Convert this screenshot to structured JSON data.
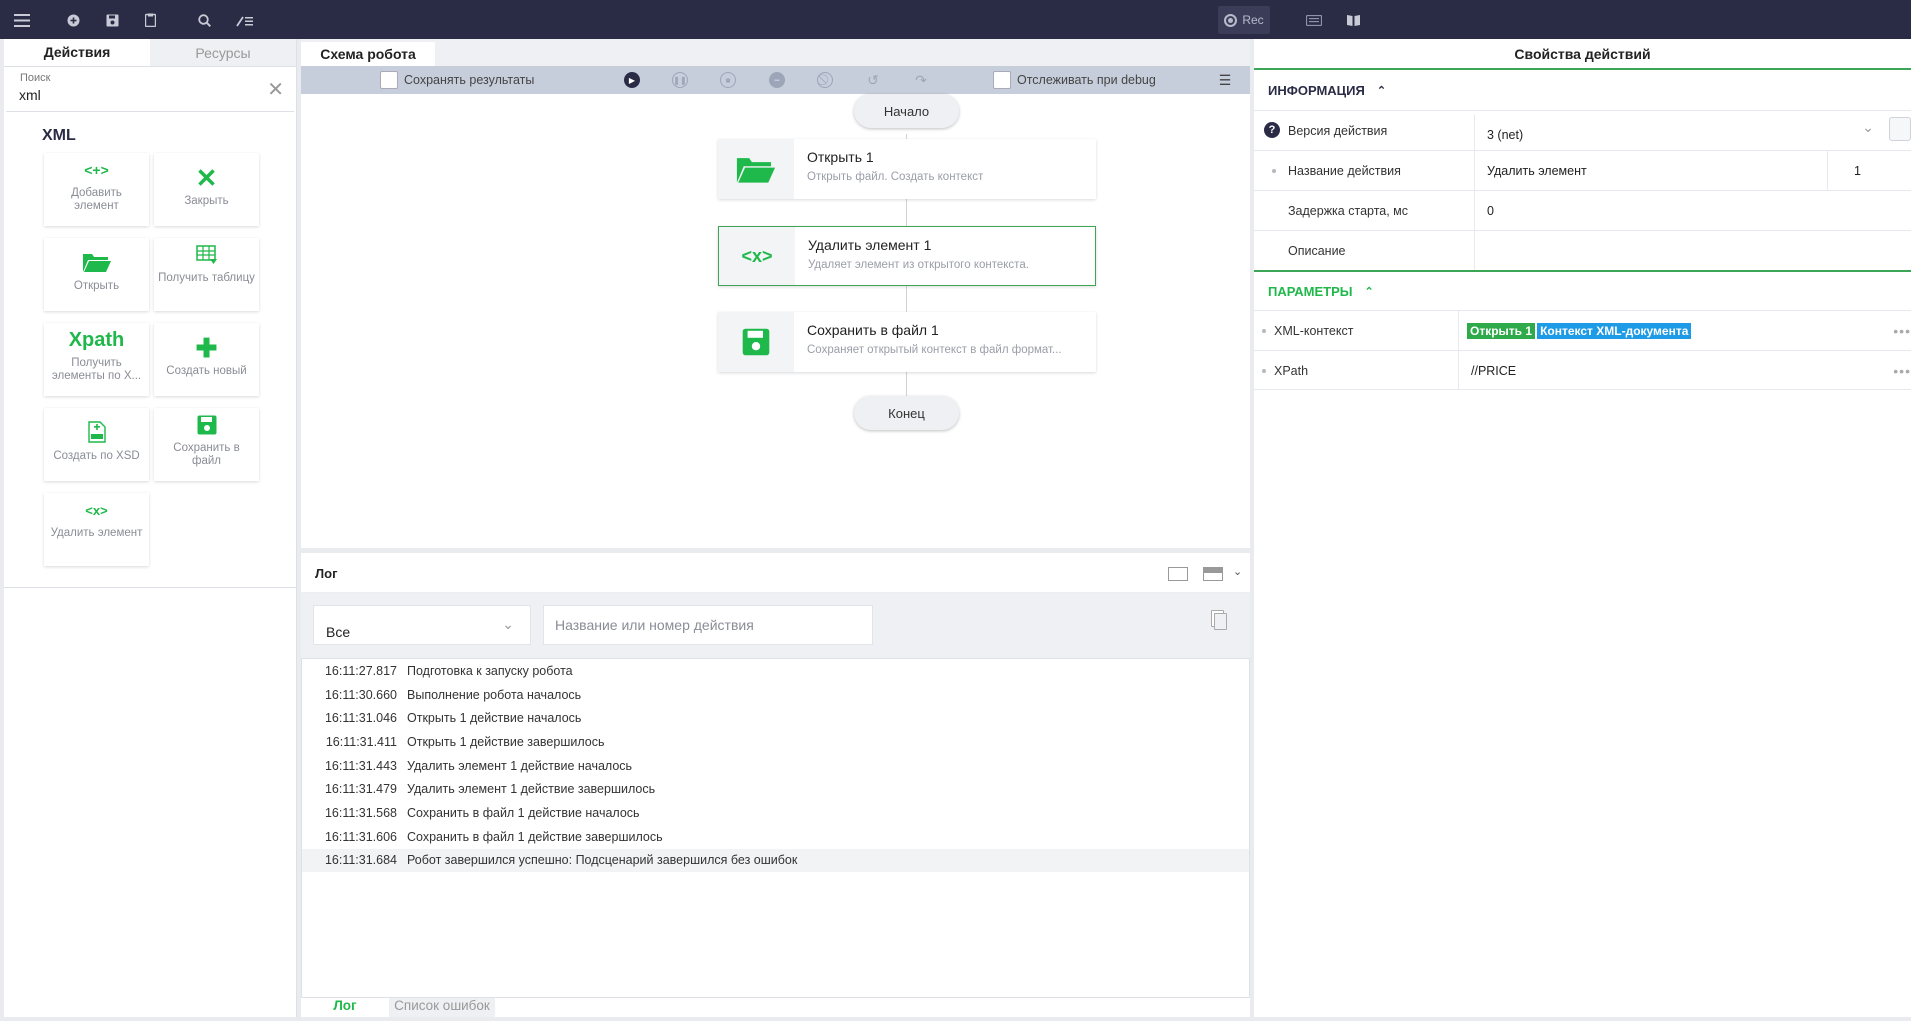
{
  "toolbar": {
    "rec_label": "Rec"
  },
  "left_panel": {
    "tabs": [
      "Действия",
      "Ресурсы"
    ],
    "search": {
      "label": "Поиск",
      "value": "xml"
    },
    "group_title": "XML",
    "tiles": [
      {
        "label": "Добавить элемент",
        "icon": "add-element-icon",
        "glyph": "<+>"
      },
      {
        "label": "Закрыть",
        "icon": "close-x-icon",
        "glyph": "✕"
      },
      {
        "label": "Открыть",
        "icon": "folder-open-icon",
        "glyph": ""
      },
      {
        "label": "Получить таблицу",
        "icon": "table-download-icon",
        "glyph": ""
      },
      {
        "label": "Получить элементы по X...",
        "icon": "xpath-icon",
        "glyph": "Xpath"
      },
      {
        "label": "Создать новый",
        "icon": "plus-icon",
        "glyph": "✚"
      },
      {
        "label": "Создать по XSD",
        "icon": "xsd-file-icon",
        "glyph": ""
      },
      {
        "label": "Сохранить в файл",
        "icon": "floppy-icon",
        "glyph": ""
      },
      {
        "label": "Удалить элемент",
        "icon": "delete-element-icon",
        "glyph": "<x>"
      }
    ]
  },
  "center": {
    "tab": "Схема робота",
    "save_results_label": "Сохранять результаты",
    "track_debug_label": "Отслеживать при debug",
    "start_label": "Начало",
    "end_label": "Конец",
    "nodes": [
      {
        "title": "Открыть  1",
        "desc": "Открыть файл. Создать контекст",
        "icon": "folder-open-icon"
      },
      {
        "title": "Удалить элемент  1",
        "desc": "Удаляет элемент из открытого контекста.",
        "icon": "delete-element-icon"
      },
      {
        "title": "Сохранить в файл  1",
        "desc": "Сохраняет открытый контекст в файл формат...",
        "icon": "floppy-icon"
      }
    ]
  },
  "log": {
    "title": "Лог",
    "filter_value": "Все",
    "search_placeholder": "Название или номер действия",
    "entries": [
      {
        "time": "16:11:27.817",
        "text": "Подготовка к запуску робота"
      },
      {
        "time": "16:11:30.660",
        "text": "Выполнение робота началось"
      },
      {
        "time": "16:11:31.046",
        "text": "Открыть 1 действие началось"
      },
      {
        "time": "16:11:31.411",
        "text": "Открыть 1 действие завершилось"
      },
      {
        "time": "16:11:31.443",
        "text": "Удалить элемент 1 действие началось"
      },
      {
        "time": "16:11:31.479",
        "text": "Удалить элемент 1 действие завершилось"
      },
      {
        "time": "16:11:31.568",
        "text": "Сохранить в файл 1 действие началось"
      },
      {
        "time": "16:11:31.606",
        "text": "Сохранить в файл 1 действие завершилось"
      },
      {
        "time": "16:11:31.684",
        "text": "Робот завершился успешно: Подсценарий завершился без ошибок"
      }
    ],
    "tabs": [
      "Лог",
      "Список ошибок"
    ]
  },
  "properties": {
    "title": "Свойства действий",
    "info_section": "ИНФОРМАЦИЯ",
    "params_section": "ПАРАМЕТРЫ",
    "version_label": "Версия действия",
    "version_value": "3 (net)",
    "name_label": "Название действия",
    "name_value": "Удалить элемент",
    "name_number": "1",
    "delay_label": "Задержка старта, мс",
    "delay_value": "0",
    "desc_label": "Описание",
    "xml_context_label": "XML-контекст",
    "xml_badge_1": "Открыть 1",
    "xml_badge_2": "Контекст XML-документа",
    "xpath_label": "XPath",
    "xpath_value": "//PRICE"
  },
  "colors": {
    "accent_green": "#1fb84a",
    "topbar": "#2a2c46",
    "badge_blue": "#1e9be6",
    "badge_green": "#2eaa4a"
  }
}
